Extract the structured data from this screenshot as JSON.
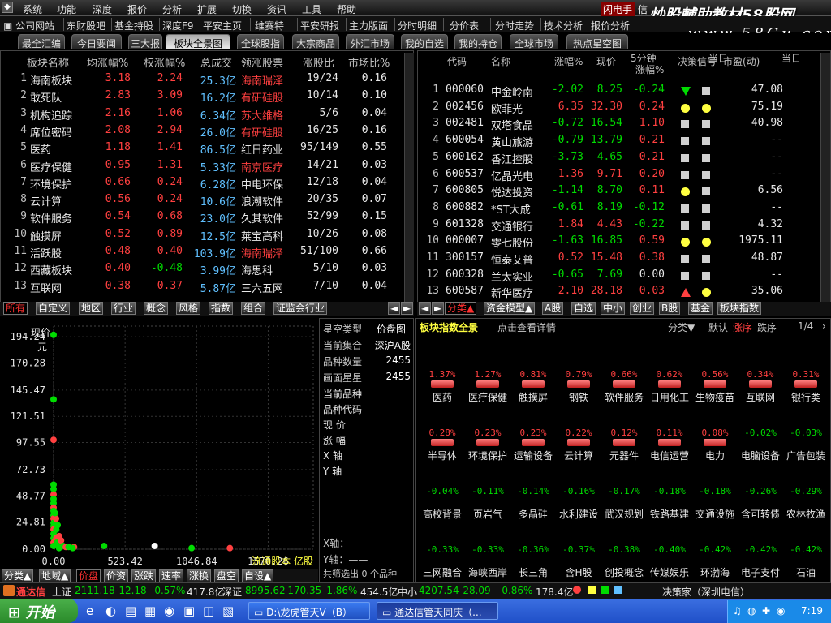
{
  "menu": [
    "系统",
    "功能",
    "深度",
    "报价",
    "分析",
    "扩展",
    "切换",
    "资讯",
    "工具",
    "帮助"
  ],
  "menu_right": {
    "label": "闪电手",
    "label2": "信"
  },
  "watermark": {
    "line1": "炒股輔助教材58股网",
    "line2": "www.58Gu.com"
  },
  "toolbar": [
    "公司网站",
    "东财股吧",
    "基金持股",
    "深度F9",
    "平安主页",
    "维赛特",
    "平安研报",
    "主力版面",
    "分时明细",
    "分价表",
    "分时走势",
    "技术分析",
    "报价分析"
  ],
  "tabs": [
    "最全汇编",
    "今日要闻",
    "三大报",
    "板块全景图",
    "全球股指",
    "大宗商品",
    "外汇市场",
    "我的自选",
    "我的持仓",
    "全球市场",
    "热点星空图"
  ],
  "left_table": {
    "headers": [
      "板块名称",
      "均涨幅%",
      "权涨幅%",
      "总成交",
      "领涨股票",
      "涨股比",
      "市场比%"
    ],
    "rows": [
      [
        "1",
        "海南板块",
        "3.18",
        "2.24",
        "25.3亿",
        "海南瑞泽",
        "19/24",
        "0.16"
      ],
      [
        "2",
        "敢死队",
        "2.83",
        "3.09",
        "16.2亿",
        "有研硅股",
        "10/14",
        "0.10"
      ],
      [
        "3",
        "机构追踪",
        "2.16",
        "1.06",
        "6.34亿",
        "苏大维格",
        "5/6",
        "0.04"
      ],
      [
        "4",
        "席位密码",
        "2.08",
        "2.94",
        "26.0亿",
        "有研硅股",
        "16/25",
        "0.16"
      ],
      [
        "5",
        "医药",
        "1.18",
        "1.41",
        "86.5亿",
        "红日药业",
        "95/149",
        "0.55"
      ],
      [
        "6",
        "医疗保健",
        "0.95",
        "1.31",
        "5.33亿",
        "南京医疗",
        "14/21",
        "0.03"
      ],
      [
        "7",
        "环境保护",
        "0.66",
        "0.24",
        "6.28亿",
        "中电环保",
        "12/18",
        "0.04"
      ],
      [
        "8",
        "云计算",
        "0.56",
        "0.24",
        "10.6亿",
        "浪潮软件",
        "20/35",
        "0.07"
      ],
      [
        "9",
        "软件服务",
        "0.54",
        "0.68",
        "23.0亿",
        "久其软件",
        "52/99",
        "0.15"
      ],
      [
        "10",
        "触摸屏",
        "0.52",
        "0.89",
        "12.5亿",
        "莱宝高科",
        "10/26",
        "0.08"
      ],
      [
        "11",
        "活跃股",
        "0.48",
        "0.40",
        "103.9亿",
        "海南瑞泽",
        "51/100",
        "0.66"
      ],
      [
        "12",
        "西藏板块",
        "0.40",
        "-0.48",
        "3.99亿",
        "海思科",
        "5/10",
        "0.03"
      ],
      [
        "13",
        "互联网",
        "0.38",
        "0.37",
        "5.87亿",
        "三六五网",
        "7/10",
        "0.04"
      ]
    ],
    "lead_hl": [
      true,
      true,
      true,
      true,
      false,
      true,
      false,
      false,
      false,
      false,
      true,
      false,
      false
    ]
  },
  "left_tabs": [
    "所有",
    "自定义",
    "地区",
    "行业",
    "概念",
    "风格",
    "指数",
    "组合",
    "证监会行业"
  ],
  "right_table": {
    "headers": [
      "代码",
      "名称",
      "涨幅%",
      "现价",
      "5分钟",
      "涨幅%",
      "决策信号",
      "当日",
      "市盈(动)",
      "当日"
    ],
    "rows": [
      [
        "1",
        "000060",
        "中金岭南",
        "-2.02",
        "8.25",
        "-0.24",
        "tri-down",
        "sq-white",
        "47.08"
      ],
      [
        "2",
        "002456",
        "欧菲光",
        "6.35",
        "32.30",
        "0.24",
        "dot-yellow",
        "dot-yellow",
        "75.19"
      ],
      [
        "3",
        "002481",
        "双塔食品",
        "-0.72",
        "16.54",
        "1.10",
        "sq-white",
        "sq-white",
        "40.98"
      ],
      [
        "4",
        "600054",
        "黄山旅游",
        "-0.79",
        "13.79",
        "0.21",
        "sq-white",
        "sq-white",
        "--"
      ],
      [
        "5",
        "600162",
        "香江控股",
        "-3.73",
        "4.65",
        "0.21",
        "sq-white",
        "sq-white",
        "--"
      ],
      [
        "6",
        "600537",
        "亿晶光电",
        "1.36",
        "9.71",
        "0.20",
        "sq-white",
        "sq-white",
        "--"
      ],
      [
        "7",
        "600805",
        "悦达投资",
        "-1.14",
        "8.70",
        "0.11",
        "dot-yellow",
        "sq-white",
        "6.56"
      ],
      [
        "8",
        "600882",
        "*ST大成",
        "-0.61",
        "8.19",
        "-0.12",
        "sq-white",
        "sq-white",
        "--"
      ],
      [
        "9",
        "601328",
        "交通银行",
        "1.84",
        "4.43",
        "-0.22",
        "sq-white",
        "sq-white",
        "4.32"
      ],
      [
        "10",
        "000007",
        "零七股份",
        "-1.63",
        "16.85",
        "0.59",
        "dot-yellow",
        "dot-yellow",
        "1975.11"
      ],
      [
        "11",
        "300157",
        "恒泰艾普",
        "0.52",
        "15.48",
        "0.38",
        "sq-white",
        "sq-white",
        "48.87"
      ],
      [
        "12",
        "600328",
        "兰太实业",
        "-0.65",
        "7.69",
        "0.00",
        "sq-white",
        "sq-white",
        "--"
      ],
      [
        "13",
        "600587",
        "新华医疗",
        "2.10",
        "28.18",
        "0.03",
        "tri-up",
        "dot-yellow",
        "35.06"
      ]
    ]
  },
  "right_tabs": [
    "分类▲",
    "资金模型▲",
    "A股",
    "自选",
    "中小",
    "创业",
    "B股",
    "基金",
    "板块指数"
  ],
  "scatter": {
    "ylabel1": "现价",
    "ylabel2": "元",
    "yticks": [
      "194.24",
      "170.28",
      "145.47",
      "121.51",
      "97.55",
      "72.73",
      "48.77",
      "24.81",
      "0.00"
    ],
    "xticks": [
      "0.00",
      "523.42",
      "1046.84",
      "1570.26"
    ],
    "xlabel": "流通股本 亿股",
    "points": [
      [
        0,
        196,
        "g"
      ],
      [
        0,
        137,
        "g"
      ],
      [
        0,
        100,
        "r"
      ],
      [
        0,
        59,
        "g"
      ],
      [
        0,
        55,
        "g"
      ],
      [
        0,
        50,
        "r"
      ],
      [
        0,
        46,
        "g"
      ],
      [
        0,
        42,
        "g"
      ],
      [
        0,
        38,
        "r"
      ],
      [
        0,
        35,
        "g"
      ],
      [
        0,
        31,
        "g"
      ],
      [
        0,
        28,
        "r"
      ],
      [
        0,
        24,
        "g"
      ],
      [
        0,
        21,
        "g"
      ],
      [
        0,
        18,
        "r"
      ],
      [
        0,
        14,
        "g"
      ],
      [
        0,
        10,
        "g"
      ],
      [
        0,
        6,
        "r"
      ],
      [
        0,
        3,
        "g"
      ],
      [
        20,
        18,
        "g"
      ],
      [
        20,
        10,
        "r"
      ],
      [
        25,
        6,
        "g"
      ],
      [
        40,
        12,
        "r"
      ],
      [
        45,
        4,
        "g"
      ],
      [
        55,
        8,
        "r"
      ],
      [
        70,
        3,
        "g"
      ],
      [
        90,
        2,
        "r"
      ],
      [
        110,
        2,
        "g"
      ],
      [
        150,
        2,
        "r"
      ],
      [
        30,
        22,
        "g"
      ],
      [
        18,
        28,
        "r"
      ],
      [
        10,
        33,
        "g"
      ],
      [
        40,
        1,
        "g"
      ],
      [
        140,
        1,
        "g"
      ],
      [
        370,
        3,
        "g"
      ],
      [
        740,
        3,
        "w"
      ],
      [
        1010,
        1,
        "g"
      ],
      [
        1290,
        1,
        "r"
      ]
    ]
  },
  "scatter_tabs": [
    "分类▲",
    "地域▲",
    "价盘",
    "价资",
    "涨跌",
    "速率",
    "涨换",
    "盘空",
    "自设▲"
  ],
  "info": {
    "title": "星空类型",
    "title_val": "价盘图",
    "rows": [
      [
        "当前集合",
        "深沪A股"
      ],
      [
        "品种数量",
        "2455"
      ],
      [
        "画面星星",
        "2455"
      ]
    ],
    "fields": [
      "当前品种",
      "品种代码",
      "现 价",
      "涨 幅",
      "X 轴",
      "Y 轴"
    ],
    "axis_x": "X轴：——",
    "axis_y": "Y轴：——",
    "filter": "共筛选出 0 个品种"
  },
  "blocks": {
    "title": "板块指数全景",
    "hint": "点击查看详情",
    "ctrl": [
      "分类▼",
      "默认",
      "涨序",
      "跌序"
    ],
    "page": "1/4",
    "tiles": [
      [
        "1.37%",
        "医药",
        "r"
      ],
      [
        "1.27%",
        "医疗保健",
        "r"
      ],
      [
        "0.81%",
        "触摸屏",
        "r"
      ],
      [
        "0.79%",
        "钢铁",
        "r"
      ],
      [
        "0.66%",
        "软件服务",
        "r"
      ],
      [
        "0.62%",
        "日用化工",
        "r"
      ],
      [
        "0.56%",
        "生物疫苗",
        "r"
      ],
      [
        "0.34%",
        "互联网",
        "r"
      ],
      [
        "0.31%",
        "银行类",
        "r"
      ],
      [
        "0.28%",
        "半导体",
        "r"
      ],
      [
        "0.23%",
        "环境保护",
        "r"
      ],
      [
        "0.23%",
        "运输设备",
        "r"
      ],
      [
        "0.22%",
        "云计算",
        "r"
      ],
      [
        "0.12%",
        "元器件",
        "r"
      ],
      [
        "0.11%",
        "电信运营",
        "r"
      ],
      [
        "0.08%",
        "电力",
        "r"
      ],
      [
        "-0.02%",
        "电脑设备",
        "g"
      ],
      [
        "-0.03%",
        "广告包装",
        "g"
      ],
      [
        "-0.04%",
        "高校背景",
        "g"
      ],
      [
        "-0.11%",
        "页岩气",
        "g"
      ],
      [
        "-0.14%",
        "多晶硅",
        "g"
      ],
      [
        "-0.16%",
        "水利建设",
        "g"
      ],
      [
        "-0.17%",
        "武汉规划",
        "g"
      ],
      [
        "-0.18%",
        "铁路基建",
        "g"
      ],
      [
        "-0.18%",
        "交通设施",
        "g"
      ],
      [
        "-0.26%",
        "含可转债",
        "g"
      ],
      [
        "-0.29%",
        "农林牧渔",
        "g"
      ],
      [
        "-0.33%",
        "三网融合",
        "g"
      ],
      [
        "-0.33%",
        "海峡西岸",
        "g"
      ],
      [
        "-0.36%",
        "长三角",
        "g"
      ],
      [
        "-0.37%",
        "含H股",
        "g"
      ],
      [
        "-0.38%",
        "创投概念",
        "g"
      ],
      [
        "-0.40%",
        "传媒娱乐",
        "g"
      ],
      [
        "-0.42%",
        "环渤海",
        "g"
      ],
      [
        "-0.42%",
        "电子支付",
        "g"
      ],
      [
        "-0.42%",
        "石油",
        "g"
      ]
    ]
  },
  "status": {
    "app": "通达信",
    "sh": "上证",
    "sh_val": "2111.18",
    "sh_chg": "-12.18",
    "sh_pct": "-0.57%",
    "sh_amt": "417.8亿",
    "sz": "深证",
    "sz_val": "8995.62",
    "sz_chg": "-170.35",
    "sz_pct": "-1.86%",
    "sz_amt": "454.5亿",
    "zx": "中小",
    "zx_val": "4207.54",
    "zx_chg": "-28.09",
    "zx_pct": "-0.86%",
    "zx_amt": "178.4亿",
    "broker": "决策家（深圳电信）"
  },
  "taskbar": {
    "start": "开始",
    "tasks": [
      "D:\\龙虎管天V（B）",
      "通达信管天同庆（..."
    ],
    "time": "7:19"
  },
  "colors": {
    "red": "#ff4040",
    "green": "#00dc00",
    "yellow": "#ffff40"
  }
}
